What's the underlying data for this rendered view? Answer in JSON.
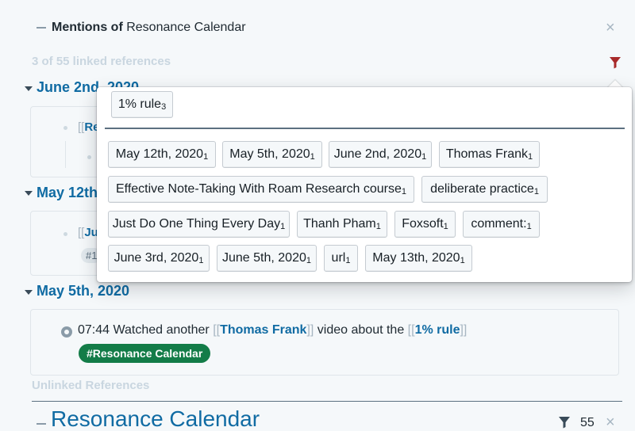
{
  "header": {
    "mentions_prefix": "Mentions of",
    "page_name": "Resonance Calendar",
    "linked_count_text": "3 of 55 linked references"
  },
  "groups": [
    {
      "date": "June 2nd, 2020",
      "frag_bracket": "[[",
      "frag_link": "Re"
    },
    {
      "date": "May 12th, 2020",
      "frag_bracket": "[[",
      "frag_link": "Ju",
      "tag_frag": "#1"
    },
    {
      "date": "May 5th, 2020"
    }
  ],
  "block": {
    "time": "07:44 Watched another",
    "link1": "Thomas Frank",
    "middle": "video about the",
    "link2": "1% rule",
    "open_br": "[[",
    "close_br": "]]",
    "tag": "#Resonance Calendar"
  },
  "unlinked_label": "Unlinked References",
  "bottom": {
    "title": "Resonance Calendar",
    "count": "55"
  },
  "filter_popover": {
    "included": [
      {
        "label": "1% rule",
        "count": "3"
      }
    ],
    "options": [
      {
        "label": "May 12th, 2020",
        "count": "1"
      },
      {
        "label": "May 5th, 2020",
        "count": "1"
      },
      {
        "label": "June 2nd, 2020",
        "count": "1"
      },
      {
        "label": "Thomas Frank",
        "count": "1"
      },
      {
        "label": "Effective Note-Taking With Roam Research course",
        "count": "1"
      },
      {
        "label": "deliberate practice",
        "count": "1"
      },
      {
        "label": "Just Do One Thing Every Day",
        "count": "1"
      },
      {
        "label": "Thanh Pham",
        "count": "1"
      },
      {
        "label": "Foxsoft",
        "count": "1"
      },
      {
        "label": "comment:",
        "count": "1"
      },
      {
        "label": "June 3rd, 2020",
        "count": "1"
      },
      {
        "label": "June 5th, 2020",
        "count": "1"
      },
      {
        "label": "url",
        "count": "1"
      },
      {
        "label": "May 13th, 2020",
        "count": "1"
      }
    ]
  },
  "colors": {
    "accent": "#106ba3",
    "filter_active": "#a82a2a",
    "tag_green": "#137c48"
  },
  "icons": [
    "dash-icon",
    "close-icon",
    "filter-icon",
    "caret-down-icon",
    "bullet-icon"
  ]
}
